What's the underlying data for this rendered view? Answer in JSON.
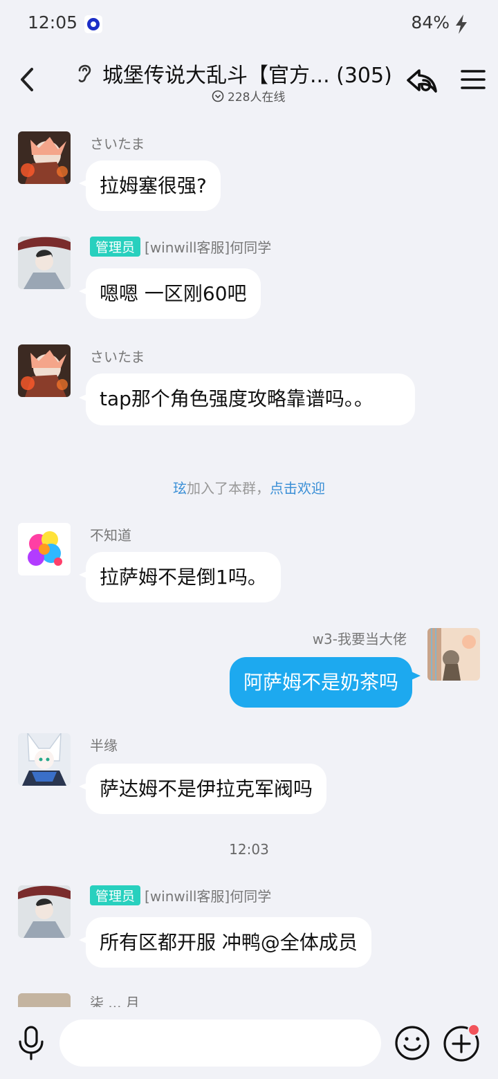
{
  "status_bar": {
    "time": "12:05",
    "battery": "84%"
  },
  "header": {
    "title": "城堡传说大乱斗【官方... (305)",
    "online": "228人在线"
  },
  "messages": [
    {
      "sender": "さいたま",
      "text": "拉姆塞很强?"
    },
    {
      "badge": "管理员",
      "sender": "[winwill客服]何同学",
      "text": "嗯嗯  一区刚60吧"
    },
    {
      "sender": "さいたま",
      "text": "tap那个角色强度攻略靠谱吗。。"
    },
    {
      "sender": "不知道",
      "text": "拉萨姆不是倒1吗。"
    },
    {
      "sender": "w3-我要当大佬",
      "text": "阿萨姆不是奶茶吗"
    },
    {
      "sender": "半缘",
      "text": "萨达姆不是伊拉克军阀吗"
    },
    {
      "badge": "管理员",
      "sender": "[winwill客服]何同学",
      "text": "所有区都开服 冲鸭@全体成员"
    },
    {
      "sender": "柒 ... 月"
    }
  ],
  "system_notice": {
    "name": "玹",
    "text": "加入了本群，",
    "link": "点击欢迎"
  },
  "time_divider": "12:03",
  "colors": {
    "accent": "#1da9ef",
    "admin_badge": "#28d0be",
    "notify_dot": "#f2545b"
  },
  "icons": [
    "back-icon",
    "ear-icon",
    "share-icon",
    "menu-icon",
    "mic-icon",
    "emoji-icon",
    "plus-icon"
  ]
}
